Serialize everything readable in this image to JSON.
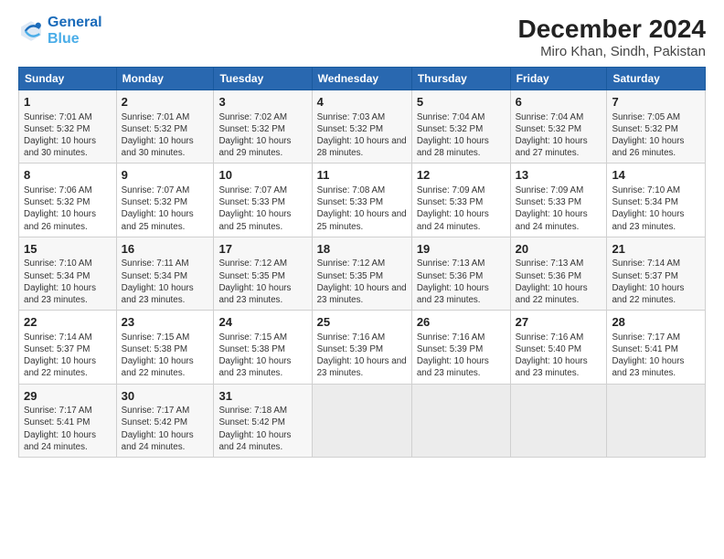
{
  "logo": {
    "line1": "General",
    "line2": "Blue"
  },
  "title": "December 2024",
  "subtitle": "Miro Khan, Sindh, Pakistan",
  "weekdays": [
    "Sunday",
    "Monday",
    "Tuesday",
    "Wednesday",
    "Thursday",
    "Friday",
    "Saturday"
  ],
  "weeks": [
    [
      {
        "day": "1",
        "sunrise": "7:01 AM",
        "sunset": "5:32 PM",
        "daylight": "10 hours and 30 minutes."
      },
      {
        "day": "2",
        "sunrise": "7:01 AM",
        "sunset": "5:32 PM",
        "daylight": "10 hours and 30 minutes."
      },
      {
        "day": "3",
        "sunrise": "7:02 AM",
        "sunset": "5:32 PM",
        "daylight": "10 hours and 29 minutes."
      },
      {
        "day": "4",
        "sunrise": "7:03 AM",
        "sunset": "5:32 PM",
        "daylight": "10 hours and 28 minutes."
      },
      {
        "day": "5",
        "sunrise": "7:04 AM",
        "sunset": "5:32 PM",
        "daylight": "10 hours and 28 minutes."
      },
      {
        "day": "6",
        "sunrise": "7:04 AM",
        "sunset": "5:32 PM",
        "daylight": "10 hours and 27 minutes."
      },
      {
        "day": "7",
        "sunrise": "7:05 AM",
        "sunset": "5:32 PM",
        "daylight": "10 hours and 26 minutes."
      }
    ],
    [
      {
        "day": "8",
        "sunrise": "7:06 AM",
        "sunset": "5:32 PM",
        "daylight": "10 hours and 26 minutes."
      },
      {
        "day": "9",
        "sunrise": "7:07 AM",
        "sunset": "5:32 PM",
        "daylight": "10 hours and 25 minutes."
      },
      {
        "day": "10",
        "sunrise": "7:07 AM",
        "sunset": "5:33 PM",
        "daylight": "10 hours and 25 minutes."
      },
      {
        "day": "11",
        "sunrise": "7:08 AM",
        "sunset": "5:33 PM",
        "daylight": "10 hours and 25 minutes."
      },
      {
        "day": "12",
        "sunrise": "7:09 AM",
        "sunset": "5:33 PM",
        "daylight": "10 hours and 24 minutes."
      },
      {
        "day": "13",
        "sunrise": "7:09 AM",
        "sunset": "5:33 PM",
        "daylight": "10 hours and 24 minutes."
      },
      {
        "day": "14",
        "sunrise": "7:10 AM",
        "sunset": "5:34 PM",
        "daylight": "10 hours and 23 minutes."
      }
    ],
    [
      {
        "day": "15",
        "sunrise": "7:10 AM",
        "sunset": "5:34 PM",
        "daylight": "10 hours and 23 minutes."
      },
      {
        "day": "16",
        "sunrise": "7:11 AM",
        "sunset": "5:34 PM",
        "daylight": "10 hours and 23 minutes."
      },
      {
        "day": "17",
        "sunrise": "7:12 AM",
        "sunset": "5:35 PM",
        "daylight": "10 hours and 23 minutes."
      },
      {
        "day": "18",
        "sunrise": "7:12 AM",
        "sunset": "5:35 PM",
        "daylight": "10 hours and 23 minutes."
      },
      {
        "day": "19",
        "sunrise": "7:13 AM",
        "sunset": "5:36 PM",
        "daylight": "10 hours and 23 minutes."
      },
      {
        "day": "20",
        "sunrise": "7:13 AM",
        "sunset": "5:36 PM",
        "daylight": "10 hours and 22 minutes."
      },
      {
        "day": "21",
        "sunrise": "7:14 AM",
        "sunset": "5:37 PM",
        "daylight": "10 hours and 22 minutes."
      }
    ],
    [
      {
        "day": "22",
        "sunrise": "7:14 AM",
        "sunset": "5:37 PM",
        "daylight": "10 hours and 22 minutes."
      },
      {
        "day": "23",
        "sunrise": "7:15 AM",
        "sunset": "5:38 PM",
        "daylight": "10 hours and 22 minutes."
      },
      {
        "day": "24",
        "sunrise": "7:15 AM",
        "sunset": "5:38 PM",
        "daylight": "10 hours and 23 minutes."
      },
      {
        "day": "25",
        "sunrise": "7:16 AM",
        "sunset": "5:39 PM",
        "daylight": "10 hours and 23 minutes."
      },
      {
        "day": "26",
        "sunrise": "7:16 AM",
        "sunset": "5:39 PM",
        "daylight": "10 hours and 23 minutes."
      },
      {
        "day": "27",
        "sunrise": "7:16 AM",
        "sunset": "5:40 PM",
        "daylight": "10 hours and 23 minutes."
      },
      {
        "day": "28",
        "sunrise": "7:17 AM",
        "sunset": "5:41 PM",
        "daylight": "10 hours and 23 minutes."
      }
    ],
    [
      {
        "day": "29",
        "sunrise": "7:17 AM",
        "sunset": "5:41 PM",
        "daylight": "10 hours and 24 minutes."
      },
      {
        "day": "30",
        "sunrise": "7:17 AM",
        "sunset": "5:42 PM",
        "daylight": "10 hours and 24 minutes."
      },
      {
        "day": "31",
        "sunrise": "7:18 AM",
        "sunset": "5:42 PM",
        "daylight": "10 hours and 24 minutes."
      },
      null,
      null,
      null,
      null
    ]
  ]
}
